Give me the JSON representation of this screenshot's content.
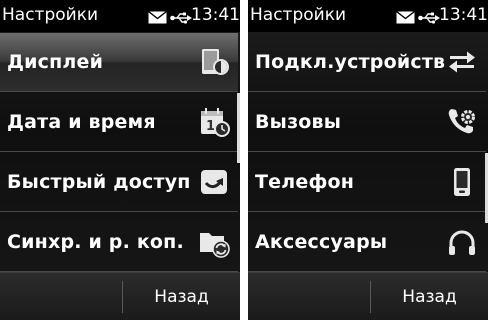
{
  "status_bar": {
    "title": "Настройки",
    "time": "13:41",
    "icons": [
      "mail-icon",
      "usb-icon"
    ]
  },
  "screens": [
    {
      "items": [
        {
          "label": "Дисплей",
          "icon": "display-settings-icon"
        },
        {
          "label": "Дата и время",
          "icon": "calendar-clock-icon"
        },
        {
          "label": "Быстрый доступ",
          "icon": "shortcut-icon"
        },
        {
          "label": "Синхр. и р. коп.",
          "icon": "sync-folder-icon"
        }
      ],
      "softkey_back": "Назад"
    },
    {
      "items": [
        {
          "label": "Подкл.устройств",
          "icon": "connectivity-arrows-icon"
        },
        {
          "label": "Вызовы",
          "icon": "call-settings-icon"
        },
        {
          "label": "Телефон",
          "icon": "phone-device-icon"
        },
        {
          "label": "Аксессуары",
          "icon": "headset-icon"
        }
      ],
      "softkey_back": "Назад"
    }
  ],
  "colors": {
    "background": "#141414",
    "status_bar": "#000000",
    "text": "#ffffff",
    "separator": "#4a4a4a"
  }
}
